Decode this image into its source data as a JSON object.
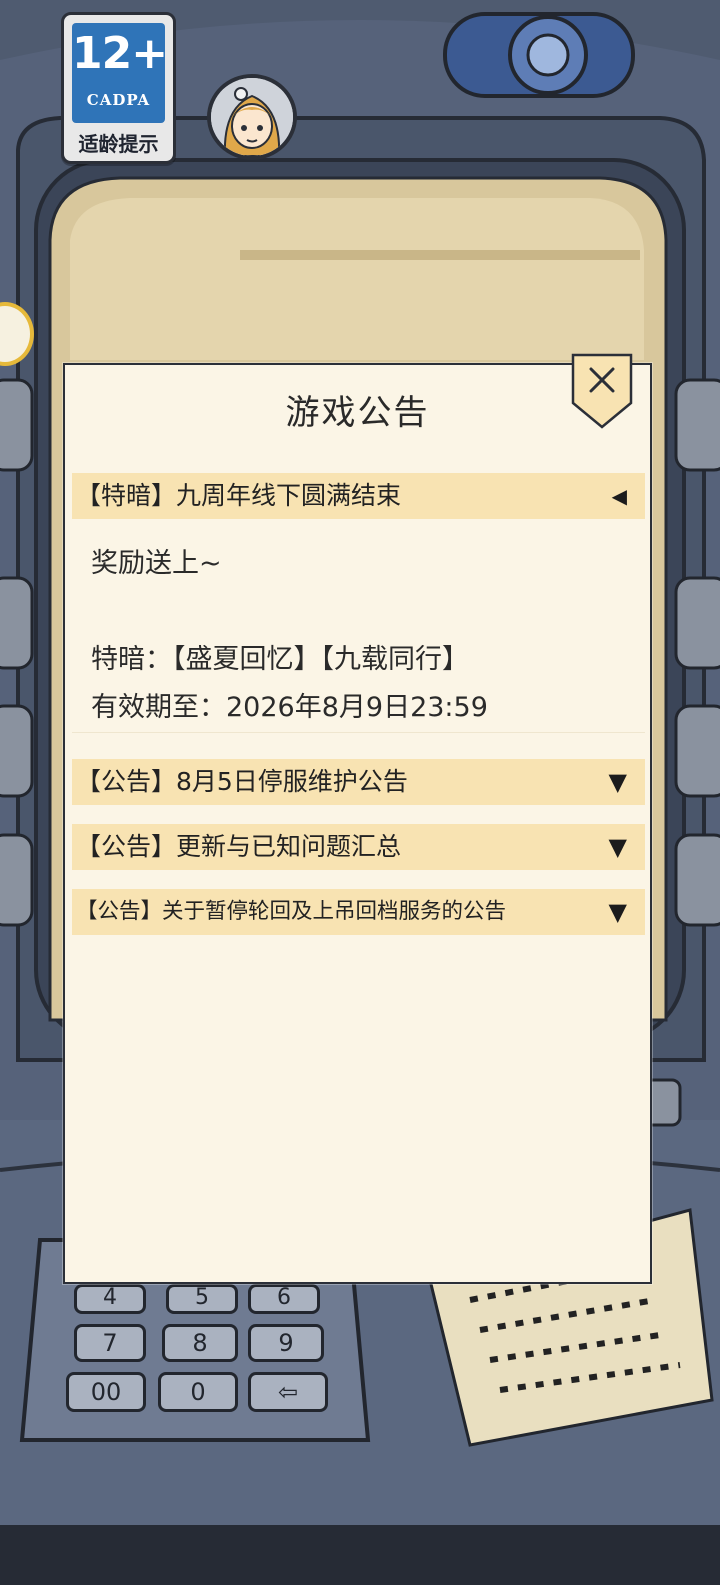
{
  "badge": {
    "age": "12+",
    "org": "CADPA",
    "tip": "适龄提示"
  },
  "panel": {
    "title": "游戏公告",
    "close_icon": "close-x-icon"
  },
  "notices": [
    {
      "title": "【特暗】九周年线下圆满结束",
      "arrow": "◀",
      "expanded": true,
      "body": [
        "奖励送上~",
        "",
        "特暗：【盛夏回忆】【九载同行】",
        "有效期至：2026年8月9日23:59"
      ]
    },
    {
      "title": "【公告】8月5日停服维护公告",
      "arrow": "▼",
      "expanded": false
    },
    {
      "title": "【公告】更新与已知问题汇总",
      "arrow": "▼",
      "expanded": false
    },
    {
      "title": "【公告】关于暂停轮回及上吊回档服务的公告",
      "arrow": "▼",
      "expanded": false
    }
  ],
  "keypad": {
    "keys": [
      "4",
      "5",
      "6",
      "7",
      "8",
      "9",
      "00",
      "0",
      "⇦"
    ]
  },
  "colors": {
    "panel_bg": "#fbf5e6",
    "notice_bar": "#f8e3b2",
    "machine": "#4a5568",
    "badge_blue": "#2f74b8"
  }
}
